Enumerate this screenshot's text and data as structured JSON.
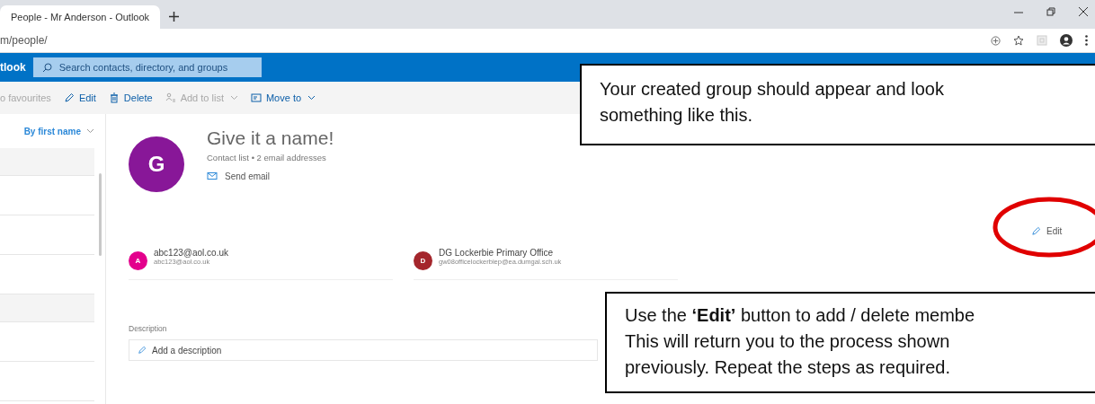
{
  "browser": {
    "tab": {
      "title": "People - Mr Anderson - Outlook",
      "selected": true
    },
    "address": "m/people/"
  },
  "header": {
    "app_name": "tlook",
    "search": {
      "placeholder": "Search contacts, directory, and groups"
    }
  },
  "toolbar": [
    {
      "label": "o favourites",
      "kind": "plain",
      "disabled": true,
      "dropdown": false
    },
    {
      "label": "Edit",
      "kind": "pencil",
      "disabled": false,
      "dropdown": false
    },
    {
      "label": "Delete",
      "kind": "trash",
      "disabled": false,
      "dropdown": false
    },
    {
      "label": "Add to list",
      "kind": "people",
      "disabled": true,
      "dropdown": true
    },
    {
      "label": "Move to",
      "kind": "folder",
      "disabled": false,
      "dropdown": true
    }
  ],
  "contact_list": {
    "sort": "By first name",
    "rows": [
      {
        "highlighted": true
      },
      {
        "highlighted": false
      },
      {
        "highlighted": false
      },
      {
        "highlighted": false
      },
      {
        "highlighted": true
      },
      {
        "highlighted": false
      },
      {
        "highlighted": false
      }
    ]
  },
  "group": {
    "initial": "G",
    "color": "#881798",
    "name": "Give it a name!",
    "subtitle": "Contact list • 2 email addresses",
    "send_email": "Send email",
    "edit": "Edit",
    "members": [
      {
        "initial": "A",
        "color": "#e3008c",
        "name": "abc123@aol.co.uk",
        "email": "abc123@aol.co.uk"
      },
      {
        "initial": "D",
        "color": "#a4262c",
        "name": "DG Lockerbie Primary Office",
        "email": "gw08officelockerbiep@ea.dumgal.sch.uk"
      }
    ],
    "description_label": "Description",
    "description_placeholder": "Add a description"
  },
  "callouts": [
    {
      "lines": [
        "Your created group should appear and look",
        "something like this."
      ]
    },
    {
      "lines": [
        "Use the **‘Edit’** button to add / delete membe",
        "This will return you to the process shown",
        "previously. Repeat the steps as required."
      ]
    }
  ]
}
